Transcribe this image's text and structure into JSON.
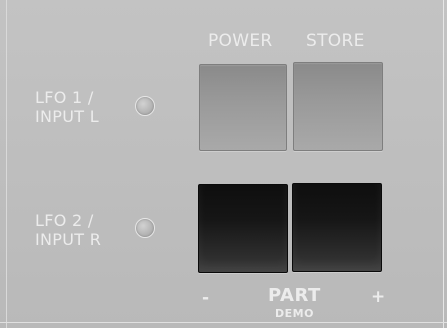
{
  "labels": {
    "power": "POWER",
    "store": "STORE",
    "lfo1_line1": "LFO 1 /",
    "lfo1_line2": "INPUT L",
    "lfo2_line1": "LFO 2 /",
    "lfo2_line2": "INPUT R",
    "minus": "-",
    "part": "PART",
    "plus": "+",
    "demo": "DEMO"
  },
  "leds": {
    "lfo1_state": "off",
    "lfo2_state": "off"
  },
  "colors": {
    "panel": "#bcbcbc",
    "label_text": "#ececec",
    "light_button": "#9a9a9a",
    "dark_button": "#1a1a1a",
    "led_off": "#b3b3b3"
  }
}
